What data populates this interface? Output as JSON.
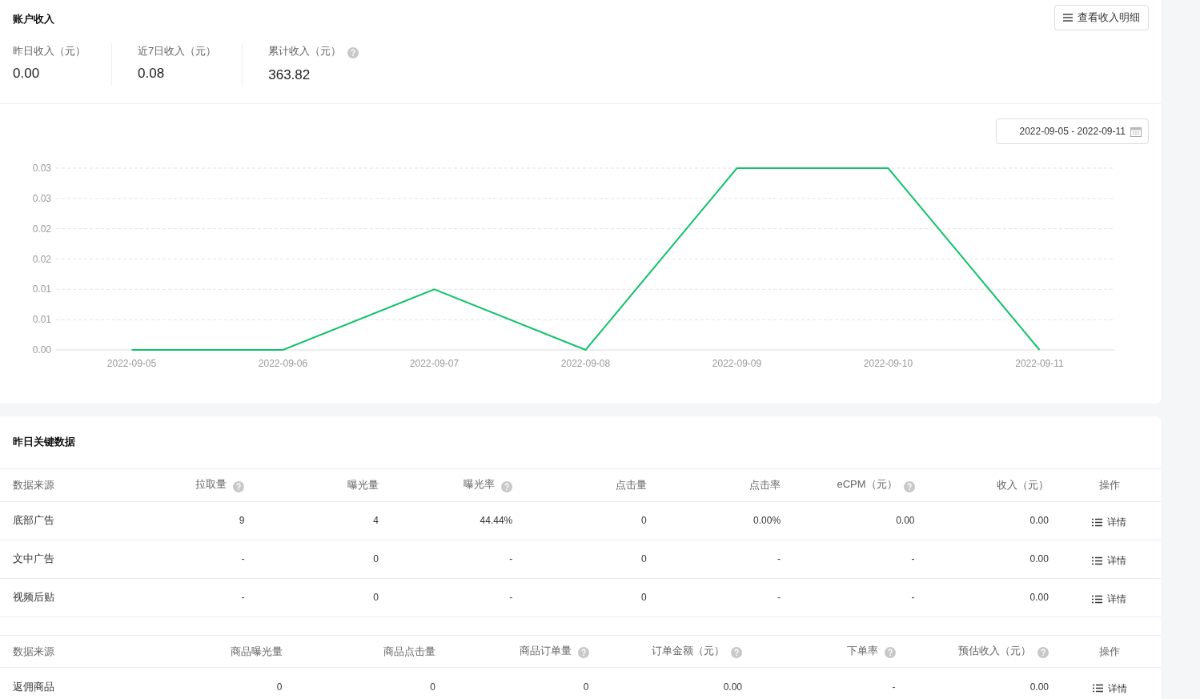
{
  "account_income": {
    "title": "账户收入",
    "detail_button": "查看收入明细",
    "stats": [
      {
        "label": "昨日收入（元）",
        "value": "0.00",
        "help": false
      },
      {
        "label": "近7日收入（元）",
        "value": "0.08",
        "help": false
      },
      {
        "label": "累计收入（元）",
        "value": "363.82",
        "help": true
      }
    ]
  },
  "trend": {
    "date_range": "2022-09-05 - 2022-09-11",
    "chart_data": {
      "type": "line",
      "categories": [
        "2022-09-05",
        "2022-09-06",
        "2022-09-07",
        "2022-09-08",
        "2022-09-09",
        "2022-09-10",
        "2022-09-11"
      ],
      "series": [
        {
          "color": "#13c26b",
          "values": [
            0,
            0,
            0.01,
            0,
            0.03,
            0.03,
            0
          ]
        }
      ],
      "grid": true,
      "ylim": [
        0,
        0.03
      ],
      "yticks": [
        {
          "value": 0,
          "label": "0.00"
        },
        {
          "value": 0.005,
          "label": "0.01"
        },
        {
          "value": 0.01,
          "label": "0.01"
        },
        {
          "value": 0.015,
          "label": "0.02"
        },
        {
          "value": 0.02,
          "label": "0.02"
        },
        {
          "value": 0.025,
          "label": "0.03"
        },
        {
          "value": 0.03,
          "label": "0.03"
        }
      ]
    }
  },
  "key_data": {
    "title": "昨日关键数据",
    "tables": [
      {
        "columns": [
          {
            "label": "数据来源",
            "help": false
          },
          {
            "label": "拉取量",
            "help": true
          },
          {
            "label": "曝光量",
            "help": false
          },
          {
            "label": "曝光率",
            "help": true
          },
          {
            "label": "点击量",
            "help": false
          },
          {
            "label": "点击率",
            "help": false
          },
          {
            "label": "eCPM（元）",
            "help": true
          },
          {
            "label": "收入（元）",
            "help": false
          },
          {
            "label": "操作",
            "help": false
          }
        ],
        "rows": [
          {
            "cells": [
              "底部广告",
              "9",
              "4",
              "44.44%",
              "0",
              "0.00%",
              "0.00",
              "0.00"
            ],
            "action": "详情"
          },
          {
            "cells": [
              "文中广告",
              "-",
              "0",
              "-",
              "0",
              "-",
              "-",
              "0.00"
            ],
            "action": "详情"
          },
          {
            "cells": [
              "视频后贴",
              "-",
              "0",
              "-",
              "0",
              "-",
              "-",
              "0.00"
            ],
            "action": "详情"
          }
        ]
      },
      {
        "columns": [
          {
            "label": "数据来源",
            "help": false
          },
          {
            "label": "商品曝光量",
            "help": false
          },
          {
            "label": "商品点击量",
            "help": false
          },
          {
            "label": "商品订单量",
            "help": true
          },
          {
            "label": "订单金额（元）",
            "help": true
          },
          {
            "label": "下单率",
            "help": true
          },
          {
            "label": "预估收入（元）",
            "help": true
          },
          {
            "label": "操作",
            "help": false
          }
        ],
        "rows": [
          {
            "cells": [
              "返佣商品",
              "0",
              "0",
              "0",
              "0.00",
              "-",
              "0.00"
            ],
            "action": "详情"
          }
        ]
      }
    ]
  }
}
